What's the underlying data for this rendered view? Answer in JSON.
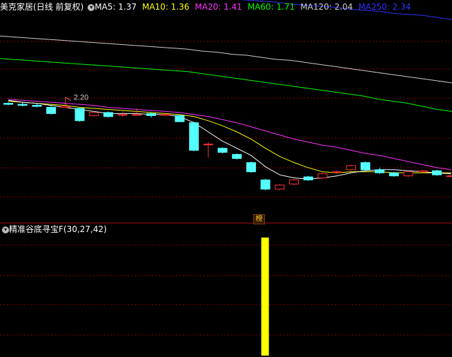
{
  "main_panel": {
    "stock_name": "美克家居",
    "period_label": "(日线 前复权)",
    "ma_items": [
      {
        "label": "MA5:",
        "value": "1.37",
        "color": "#ffffff"
      },
      {
        "label": "MA10:",
        "value": "1.36",
        "color": "#ffff00"
      },
      {
        "label": "MA20:",
        "value": "1.41",
        "color": "#ff33ff"
      },
      {
        "label": "MA60:",
        "value": "1.71",
        "color": "#00ff00"
      },
      {
        "label": "MA120:",
        "value": "2.04",
        "color": "#cccccc"
      },
      {
        "label": "MA250:",
        "value": "2.34",
        "color": "#3333ff"
      }
    ],
    "high_marker": "2.20",
    "badge_text": "榜"
  },
  "indicator_panel": {
    "name": "精准谷底寻宝F",
    "params": "(30,27,42)"
  },
  "colors": {
    "up": "#ff3333",
    "down": "#54ffff",
    "grid": "#8b0000",
    "separator": "#b01010",
    "signal_bar": "#ffff00"
  },
  "chart_data": {
    "type": "candlestick",
    "ohlc": [
      [
        1.84,
        1.85,
        1.82,
        1.83
      ],
      [
        1.83,
        1.85,
        1.81,
        1.82
      ],
      [
        1.82,
        1.84,
        1.8,
        1.81
      ],
      [
        1.8,
        1.82,
        1.73,
        1.74
      ],
      [
        1.8,
        1.82,
        1.8,
        1.81
      ],
      [
        1.79,
        1.8,
        1.66,
        1.67
      ],
      [
        1.72,
        1.76,
        1.71,
        1.75
      ],
      [
        1.75,
        1.76,
        1.7,
        1.71
      ],
      [
        1.73,
        1.76,
        1.71,
        1.73
      ],
      [
        1.73,
        1.79,
        1.72,
        1.73
      ],
      [
        1.74,
        1.75,
        1.7,
        1.72
      ],
      [
        1.73,
        1.74,
        1.72,
        1.73
      ],
      [
        1.72,
        1.73,
        1.66,
        1.66
      ],
      [
        1.65,
        1.66,
        1.37,
        1.38
      ],
      [
        1.44,
        1.46,
        1.31,
        1.44
      ],
      [
        1.4,
        1.41,
        1.35,
        1.36
      ],
      [
        1.34,
        1.35,
        1.29,
        1.3
      ],
      [
        1.26,
        1.27,
        1.16,
        1.17
      ],
      [
        1.09,
        1.1,
        0.99,
        1.0
      ],
      [
        1.0,
        1.05,
        0.99,
        1.04
      ],
      [
        1.05,
        1.1,
        1.04,
        1.09
      ],
      [
        1.12,
        1.13,
        1.08,
        1.09
      ],
      [
        1.11,
        1.16,
        1.1,
        1.15
      ],
      [
        1.17,
        1.18,
        1.16,
        1.17
      ],
      [
        1.19,
        1.24,
        1.18,
        1.23
      ],
      [
        1.26,
        1.27,
        1.18,
        1.19
      ],
      [
        1.19,
        1.21,
        1.15,
        1.16
      ],
      [
        1.16,
        1.17,
        1.12,
        1.13
      ],
      [
        1.13,
        1.18,
        1.12,
        1.17
      ],
      [
        1.17,
        1.19,
        1.16,
        1.18
      ],
      [
        1.18,
        1.19,
        1.13,
        1.14
      ],
      [
        1.13,
        1.14,
        1.12,
        1.13
      ]
    ],
    "ma_lines": {
      "MA5": [
        1.87,
        1.85,
        1.84,
        1.82,
        1.8,
        1.78,
        1.76,
        1.74,
        1.74,
        1.74,
        1.73,
        1.73,
        1.71,
        1.65,
        1.56,
        1.47,
        1.4,
        1.33,
        1.22,
        1.14,
        1.11,
        1.1,
        1.11,
        1.13,
        1.16,
        1.18,
        1.19,
        1.19,
        1.18,
        1.17,
        1.16,
        1.15
      ],
      "MA10": [
        1.86,
        1.85,
        1.84,
        1.83,
        1.82,
        1.8,
        1.79,
        1.78,
        1.77,
        1.76,
        1.75,
        1.74,
        1.73,
        1.71,
        1.67,
        1.62,
        1.56,
        1.49,
        1.4,
        1.32,
        1.26,
        1.21,
        1.17,
        1.16,
        1.17,
        1.17,
        1.17,
        1.16,
        1.16,
        1.16,
        1.16,
        1.16
      ],
      "MA20": [
        1.88,
        1.87,
        1.86,
        1.85,
        1.84,
        1.83,
        1.82,
        1.8,
        1.79,
        1.78,
        1.77,
        1.76,
        1.75,
        1.73,
        1.71,
        1.68,
        1.65,
        1.61,
        1.57,
        1.53,
        1.49,
        1.46,
        1.43,
        1.41,
        1.38,
        1.35,
        1.33,
        1.3,
        1.27,
        1.24,
        1.21,
        1.19
      ],
      "MA60": [
        2.28,
        2.27,
        2.26,
        2.25,
        2.24,
        2.23,
        2.22,
        2.21,
        2.2,
        2.19,
        2.18,
        2.17,
        2.16,
        2.15,
        2.13,
        2.11,
        2.09,
        2.07,
        2.05,
        2.03,
        2.01,
        1.99,
        1.97,
        1.95,
        1.93,
        1.91,
        1.88,
        1.86,
        1.84,
        1.81,
        1.78,
        1.76
      ],
      "MA120": [
        2.5,
        2.49,
        2.48,
        2.47,
        2.46,
        2.45,
        2.44,
        2.43,
        2.42,
        2.41,
        2.4,
        2.39,
        2.38,
        2.37,
        2.35,
        2.34,
        2.32,
        2.31,
        2.29,
        2.27,
        2.26,
        2.24,
        2.22,
        2.2,
        2.18,
        2.16,
        2.14,
        2.12,
        2.1,
        2.08,
        2.06,
        2.04
      ],
      "MA250": [
        3.02,
        3.01,
        3.0,
        2.99,
        2.98,
        2.97,
        2.96,
        2.95,
        2.94,
        2.93,
        2.92,
        2.91,
        2.9,
        2.89,
        2.88,
        2.87,
        2.86,
        2.85,
        2.84,
        2.83,
        2.81,
        2.8,
        2.79,
        2.78,
        2.76,
        2.75,
        2.74,
        2.72,
        2.71,
        2.7,
        2.68,
        2.66
      ]
    },
    "signal": {
      "index": 18,
      "value": 1
    }
  }
}
